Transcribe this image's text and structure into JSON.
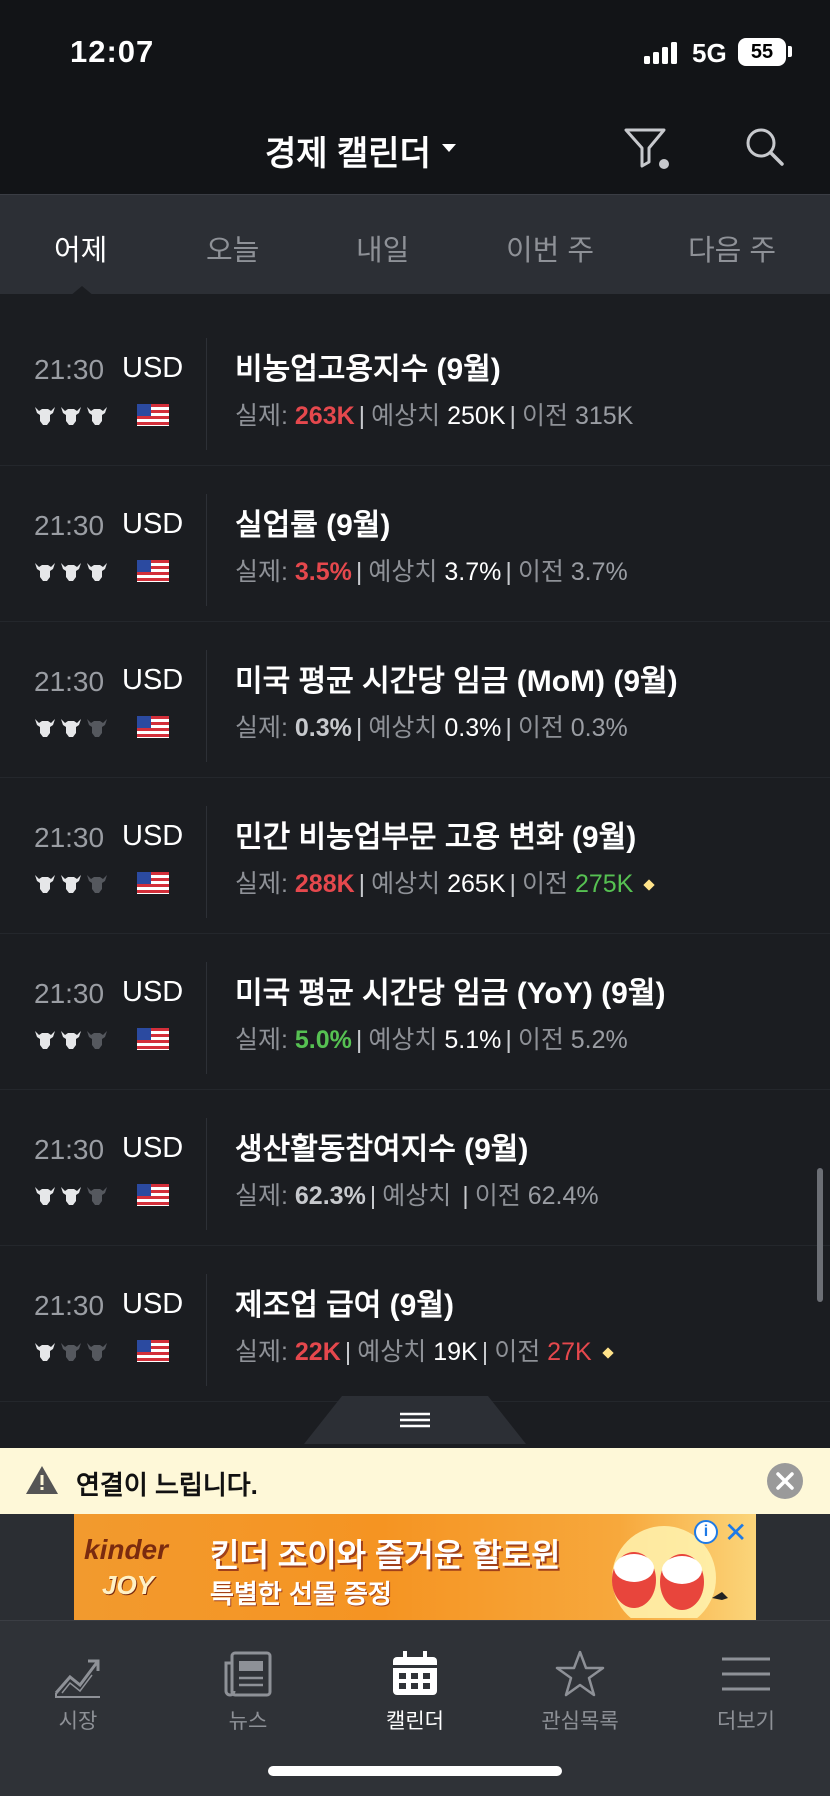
{
  "status_bar": {
    "time": "12:07",
    "network": "5G",
    "battery": "55"
  },
  "header": {
    "title": "경제 캘린더",
    "filter_icon": "filter-icon",
    "search_icon": "search-icon"
  },
  "tabs": [
    {
      "label": "어제",
      "active": true
    },
    {
      "label": "오늘",
      "active": false
    },
    {
      "label": "내일",
      "active": false
    },
    {
      "label": "이번 주",
      "active": false
    },
    {
      "label": "다음 주",
      "active": false
    }
  ],
  "labels": {
    "actual": "실제: ",
    "forecast": "예상치 ",
    "previous": "이전 "
  },
  "events": [
    {
      "time": "21:30",
      "currency": "USD",
      "importance": 3,
      "name": "비농업고용지수 (9월)",
      "actual": "263K",
      "actual_color": "red",
      "forecast": "250K",
      "previous": "315K",
      "previous_color": "grey",
      "revised": false
    },
    {
      "time": "21:30",
      "currency": "USD",
      "importance": 3,
      "name": "실업률 (9월)",
      "actual": "3.5%",
      "actual_color": "red",
      "forecast": "3.7%",
      "previous": "3.7%",
      "previous_color": "grey",
      "revised": false
    },
    {
      "time": "21:30",
      "currency": "USD",
      "importance": 2,
      "name": "미국 평균 시간당 임금 (MoM) (9월)",
      "actual": "0.3%",
      "actual_color": "neutral",
      "forecast": "0.3%",
      "previous": "0.3%",
      "previous_color": "grey",
      "revised": false
    },
    {
      "time": "21:30",
      "currency": "USD",
      "importance": 2,
      "name": "민간 비농업부문 고용 변화 (9월)",
      "actual": "288K",
      "actual_color": "red",
      "forecast": "265K",
      "previous": "275K",
      "previous_color": "green",
      "revised": true
    },
    {
      "time": "21:30",
      "currency": "USD",
      "importance": 2,
      "name": "미국 평균 시간당 임금 (YoY) (9월)",
      "actual": "5.0%",
      "actual_color": "green",
      "forecast": "5.1%",
      "previous": "5.2%",
      "previous_color": "grey",
      "revised": false
    },
    {
      "time": "21:30",
      "currency": "USD",
      "importance": 2,
      "name": "생산활동참여지수 (9월)",
      "actual": "62.3%",
      "actual_color": "neutral",
      "forecast": "",
      "previous": "62.4%",
      "previous_color": "grey",
      "revised": false
    },
    {
      "time": "21:30",
      "currency": "USD",
      "importance": 1,
      "name": "제조업 급여 (9월)",
      "actual": "22K",
      "actual_color": "red",
      "forecast": "19K",
      "previous": "27K",
      "previous_color": "red",
      "revised": true
    }
  ],
  "warning": {
    "text": "연결이 느립니다."
  },
  "ad": {
    "brand_top": "kinder",
    "brand_bottom": "JOY",
    "line1": "킨더 조이와 즐거운 할로윈",
    "line2": "특별한 선물 증정",
    "info": "i",
    "close": "✕"
  },
  "bottom_nav": [
    {
      "label": "시장",
      "icon": "chart-icon",
      "active": false
    },
    {
      "label": "뉴스",
      "icon": "news-icon",
      "active": false
    },
    {
      "label": "캘린더",
      "icon": "calendar-icon",
      "active": true
    },
    {
      "label": "관심목록",
      "icon": "star-icon",
      "active": false
    },
    {
      "label": "더보기",
      "icon": "menu-icon",
      "active": false
    }
  ],
  "colors": {
    "red": "#e5484d",
    "green": "#56c152",
    "background": "#1b1d21",
    "header": "#121417",
    "tabbar": "#2c2f35"
  }
}
